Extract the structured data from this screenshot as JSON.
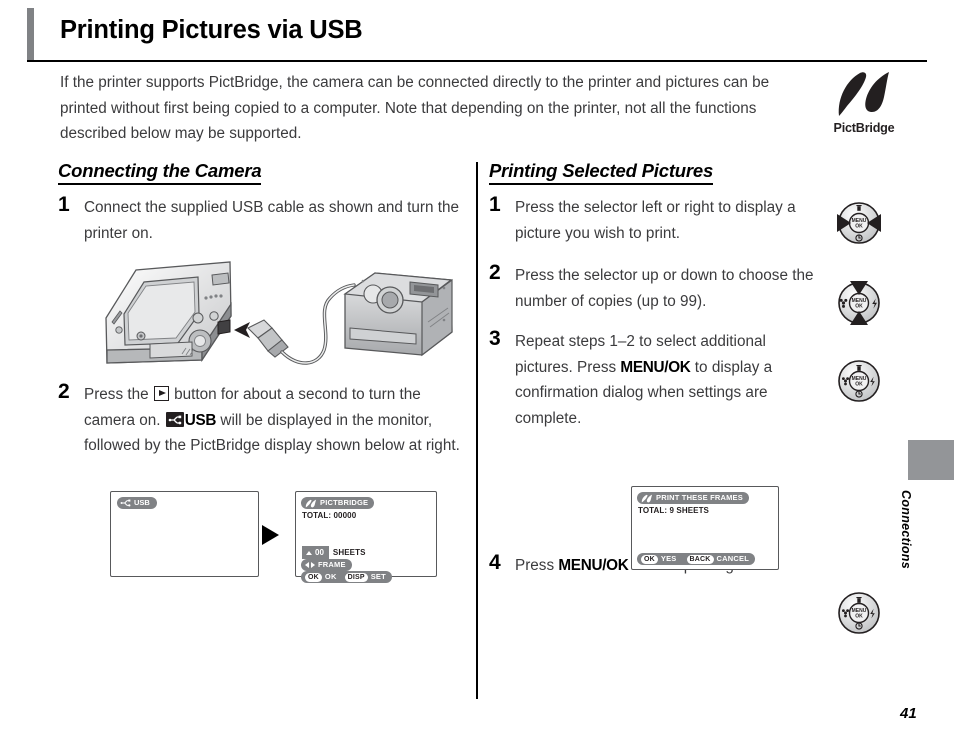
{
  "page": {
    "title": "Printing Pictures via USB",
    "intro": "If the printer supports PictBridge, the camera can be connected directly to the printer and pictures can be printed without first being copied to a computer.  Note that depending on the printer, not all the functions described below may be supported.",
    "folio": "41",
    "side_tab_label": "Connections",
    "logo_word": "PictBridge"
  },
  "left_column": {
    "heading": "Connecting the Camera",
    "steps": [
      {
        "num": "1",
        "text": "Connect the supplied USB cable as shown and turn the printer on."
      },
      {
        "num": "2",
        "text_a": "Press the ",
        "text_b": " button for about a second to turn the camera on.  ",
        "usb_label": "USB",
        "text_c": " will be displayed in the monitor, followed by the PictBridge display shown below at right."
      }
    ]
  },
  "right_column": {
    "heading": "Printing Selected Pictures",
    "steps": [
      {
        "num": "1",
        "text": "Press the selector left or right to display a picture you wish to print."
      },
      {
        "num": "2",
        "text": "Press the selector up or down to choose the number of copies (up to 99)."
      },
      {
        "num": "3",
        "text_a": "Repeat steps 1–2 to select additional pictures.  Press ",
        "bold": "MENU/OK",
        "text_b": " to display a confirmation dialog when settings are complete."
      },
      {
        "num": "4",
        "text_a": "Press ",
        "bold": "MENU/OK",
        "text_b": " to start printing."
      }
    ]
  },
  "screens": {
    "usb_screen": {
      "badge": "USB"
    },
    "pictbridge_screen": {
      "badge": "PICTBRIDGE",
      "total": "TOTAL: 00000",
      "sheets_count": "00",
      "sheets_label": "SHEETS",
      "frame_key": "FRAME",
      "ok_key": "OK",
      "ok_prefix": "OK",
      "set_key": "SET",
      "set_prefix": "DISP"
    },
    "confirm_screen": {
      "badge": "PRINT THESE FRAMES",
      "total": "TOTAL: 9 SHEETS",
      "yes_label": "YES",
      "yes_key": "OK",
      "cancel_label": "CANCEL",
      "cancel_key": "BACK"
    }
  },
  "selector_icons": {
    "center_label_line1": "MENU",
    "center_label_line2": "OK",
    "icon_1": "selector-left-right",
    "icon_2": "selector-up-down",
    "icon_3": "selector-menu-ok",
    "icon_4": "selector-menu-ok"
  },
  "colors": {
    "accent_gray": "#808285",
    "tab_gray": "#939598",
    "text_gray": "#3b3b3d",
    "black": "#000000"
  }
}
